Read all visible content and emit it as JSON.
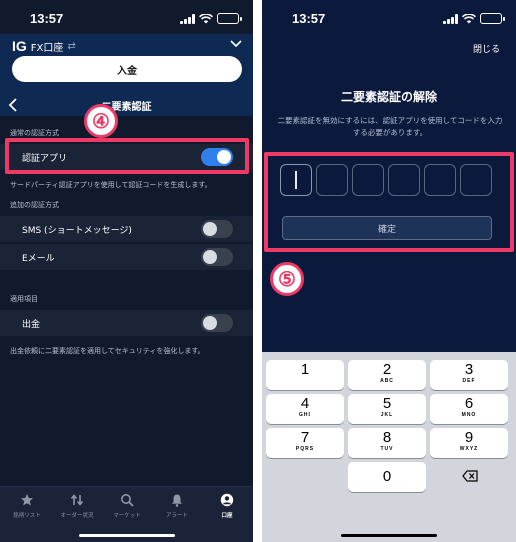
{
  "left": {
    "status": {
      "time": "13:57"
    },
    "header": {
      "logo": "IG",
      "account": "FX口座",
      "deposit_label": "入金"
    },
    "nav": {
      "title": "二要素認証"
    },
    "sections": {
      "primary_label": "通常の認証方式",
      "additional_label": "追加の認証方式",
      "applies_label": "適用項目"
    },
    "rows": {
      "auth_app": {
        "label": "認証アプリ",
        "enabled": true
      },
      "sms": {
        "label": "SMS (ショートメッセージ)",
        "enabled": false
      },
      "email": {
        "label": "Eメール",
        "enabled": false
      },
      "withdrawal": {
        "label": "出金",
        "enabled": false
      }
    },
    "helpers": {
      "auth_app": "サードパーティ認証アプリを使用して認証コードを生成します。",
      "withdrawal": "出金依頼に二要素認証を適用してセキュリティを強化します。"
    },
    "step_badge": "④",
    "tabs": [
      {
        "label": "銘柄リスト",
        "icon": "star-icon"
      },
      {
        "label": "オーダー状況",
        "icon": "arrows-icon"
      },
      {
        "label": "マーケット",
        "icon": "search-icon"
      },
      {
        "label": "アラート",
        "icon": "bell-icon"
      },
      {
        "label": "口座",
        "icon": "account-icon",
        "active": true
      }
    ]
  },
  "right": {
    "status": {
      "time": "13:57"
    },
    "close_label": "閉じる",
    "title": "二要素認証の解除",
    "description": "二要素認証を無効にするには、認証アプリを使用してコードを入力する必要があります。",
    "confirm_label": "確定",
    "step_badge": "⑤",
    "keypad": [
      {
        "num": "1",
        "letters": ""
      },
      {
        "num": "2",
        "letters": "ABC"
      },
      {
        "num": "3",
        "letters": "DEF"
      },
      {
        "num": "4",
        "letters": "GHI"
      },
      {
        "num": "5",
        "letters": "JKL"
      },
      {
        "num": "6",
        "letters": "MNO"
      },
      {
        "num": "7",
        "letters": "PQRS"
      },
      {
        "num": "8",
        "letters": "TUV"
      },
      {
        "num": "9",
        "letters": "WXYZ"
      },
      {
        "num": "0",
        "letters": ""
      }
    ]
  },
  "colors": {
    "highlight": "#ee3a65",
    "toggle_on": "#2f80ed",
    "header_bg": "#0e2a52",
    "right_bg": "#0b1a3c"
  }
}
